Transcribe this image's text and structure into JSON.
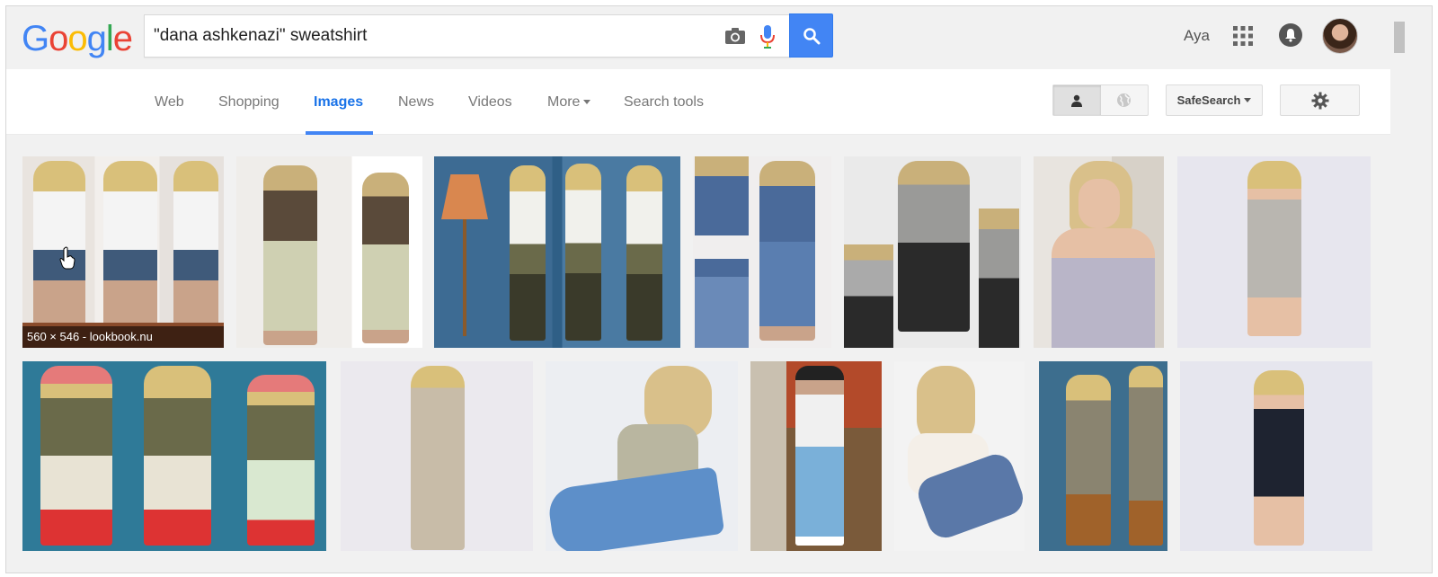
{
  "header": {
    "logo_letters": [
      "G",
      "o",
      "o",
      "g",
      "l",
      "e"
    ],
    "search_value": "\"dana ashkenazi\" sweatshirt",
    "user_name": "Aya"
  },
  "tabs": [
    {
      "label": "Web",
      "active": false
    },
    {
      "label": "Shopping",
      "active": false
    },
    {
      "label": "Images",
      "active": true
    },
    {
      "label": "News",
      "active": false
    },
    {
      "label": "Videos",
      "active": false
    },
    {
      "label": "More",
      "active": false,
      "dropdown": true
    },
    {
      "label": "Search tools",
      "active": false
    }
  ],
  "toolbar": {
    "safesearch_label": "SafeSearch"
  },
  "results": {
    "hover_caption": "560 × 546 - lookbook.nu",
    "row1_count": 7,
    "row2_count": 7
  },
  "colors": {
    "accent": "#4285f4",
    "page_bg": "#f1f1f1"
  }
}
